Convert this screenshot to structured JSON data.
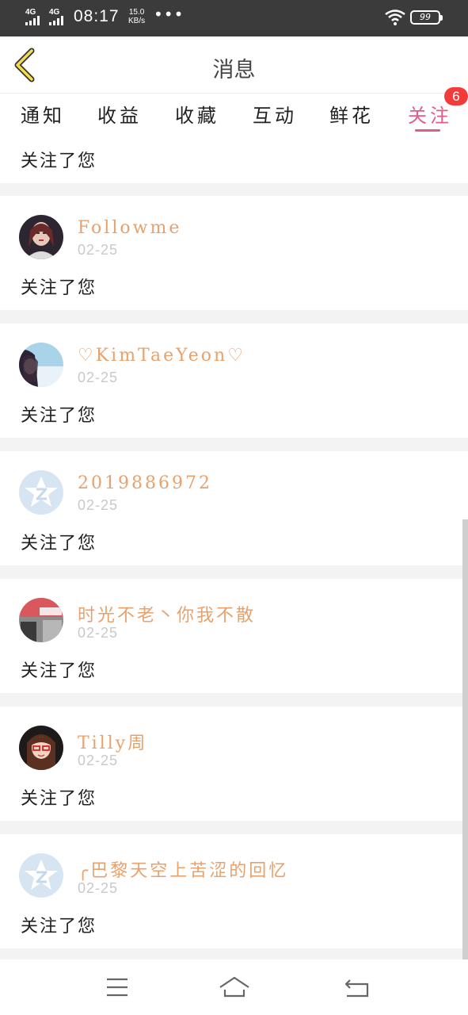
{
  "status_bar": {
    "signal1": "4G",
    "signal2": "4G",
    "time": "08:17",
    "speed_value": "15.0",
    "speed_unit": "KB/s",
    "dots": "•••",
    "battery": "99"
  },
  "header": {
    "title": "消息",
    "back_icon": "chevron-left-icon"
  },
  "tabs": [
    {
      "label": "通知",
      "active": false
    },
    {
      "label": "收益",
      "active": false
    },
    {
      "label": "收藏",
      "active": false
    },
    {
      "label": "互动",
      "active": false
    },
    {
      "label": "鲜花",
      "active": false
    },
    {
      "label": "关注",
      "active": true
    }
  ],
  "tab_badge": "6",
  "accent_color": "#e05c8a",
  "name_color": "#e9a16c",
  "partial_card": {
    "message": "关注了您"
  },
  "items": [
    {
      "name": "Followme",
      "date": "02-25",
      "message": "关注了您",
      "avatar": "photo-avatar"
    },
    {
      "name": "♡KimTaeYeon♡",
      "date": "02-25",
      "message": "关注了您",
      "avatar": "photo-avatar"
    },
    {
      "name": "2019886972",
      "date": "02-25",
      "message": "关注了您",
      "avatar": "default-qzone-avatar"
    },
    {
      "name": "时光不老丶你我不散",
      "date": "02-25",
      "message": "关注了您",
      "avatar": "photo-avatar"
    },
    {
      "name": "Tilly周",
      "date": "02-25",
      "message": "关注了您",
      "avatar": "cartoon-avatar"
    },
    {
      "name": "╭巴黎天空上苦涩的回忆",
      "date": "02-25",
      "message": "关注了您",
      "avatar": "default-qzone-avatar"
    }
  ],
  "nav": {
    "menu_icon": "menu-icon",
    "home_icon": "home-icon",
    "back_icon": "back-arrow-icon"
  }
}
